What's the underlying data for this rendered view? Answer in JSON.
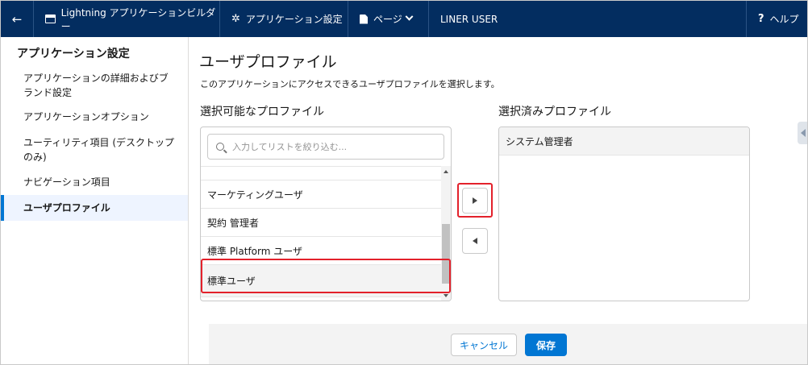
{
  "topbar": {
    "back_icon": "arrow-left-icon",
    "builder_label": "Lightning アプリケーションビルダー",
    "settings_label": "アプリケーション設定",
    "page_label": "ページ",
    "user_label": "LINER USER",
    "help_label": "ヘルプ",
    "bg_color": "#032d60"
  },
  "sidebar": {
    "title": "アプリケーション設定",
    "items": [
      {
        "label": "アプリケーションの詳細およびブランド設定"
      },
      {
        "label": "アプリケーションオプション"
      },
      {
        "label": "ユーティリティ項目 (デスクトップのみ)"
      },
      {
        "label": "ナビゲーション項目"
      },
      {
        "label": "ユーザプロファイル",
        "active": true
      }
    ]
  },
  "main": {
    "title": "ユーザプロファイル",
    "description": "このアプリケーションにアクセスできるユーザプロファイルを選択します。",
    "available_label": "選択可能なプロファイル",
    "selected_label": "選択済みプロファイル",
    "search_placeholder": "入力してリストを絞り込む...",
    "available_items": [
      {
        "label": "マーケティングユーザ"
      },
      {
        "label": "契約 管理者"
      },
      {
        "label": "標準 Platform ユーザ"
      },
      {
        "label": "標準ユーザ",
        "selected": true
      }
    ],
    "selected_items": [
      {
        "label": "システム管理者"
      }
    ]
  },
  "footer": {
    "cancel_label": "キャンセル",
    "save_label": "保存"
  },
  "colors": {
    "brand_blue": "#0176d3",
    "highlight_red": "#e3212b"
  }
}
